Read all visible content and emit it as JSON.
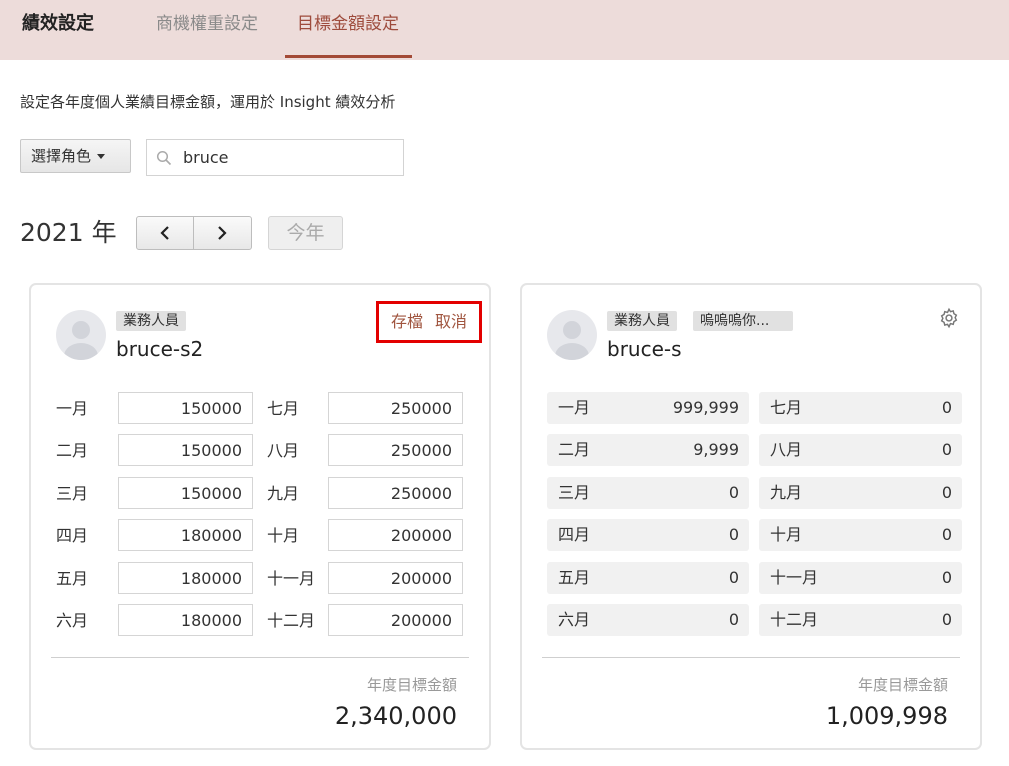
{
  "header": {
    "title": "績效設定",
    "tabs": [
      {
        "label": "商機權重設定",
        "active": false
      },
      {
        "label": "目標金額設定",
        "active": true
      }
    ]
  },
  "description": "設定各年度個人業績目標金額，運用於 Insight 績效分析",
  "filters": {
    "role_button": "選擇角色",
    "search_value": "bruce"
  },
  "year_nav": {
    "year_label": "2021 年",
    "today_label": "今年"
  },
  "cards": [
    {
      "badges": [
        "業務人員"
      ],
      "name": "bruce-s2",
      "editing": true,
      "save_label": "存檔",
      "cancel_label": "取消",
      "months_left": [
        {
          "label": "一月",
          "value": "150000"
        },
        {
          "label": "二月",
          "value": "150000"
        },
        {
          "label": "三月",
          "value": "150000"
        },
        {
          "label": "四月",
          "value": "180000"
        },
        {
          "label": "五月",
          "value": "180000"
        },
        {
          "label": "六月",
          "value": "180000"
        }
      ],
      "months_right": [
        {
          "label": "七月",
          "value": "250000"
        },
        {
          "label": "八月",
          "value": "250000"
        },
        {
          "label": "九月",
          "value": "250000"
        },
        {
          "label": "十月",
          "value": "200000"
        },
        {
          "label": "十一月",
          "value": "200000"
        },
        {
          "label": "十二月",
          "value": "200000"
        }
      ],
      "total_label": "年度目標金額",
      "total_value": "2,340,000"
    },
    {
      "badges": [
        "業務人員",
        "嗚嗚嗚你..."
      ],
      "name": "bruce-s",
      "editing": false,
      "months_left": [
        {
          "label": "一月",
          "value": "999,999"
        },
        {
          "label": "二月",
          "value": "9,999"
        },
        {
          "label": "三月",
          "value": "0"
        },
        {
          "label": "四月",
          "value": "0"
        },
        {
          "label": "五月",
          "value": "0"
        },
        {
          "label": "六月",
          "value": "0"
        }
      ],
      "months_right": [
        {
          "label": "七月",
          "value": "0"
        },
        {
          "label": "八月",
          "value": "0"
        },
        {
          "label": "九月",
          "value": "0"
        },
        {
          "label": "十月",
          "value": "0"
        },
        {
          "label": "十一月",
          "value": "0"
        },
        {
          "label": "十二月",
          "value": "0"
        }
      ],
      "total_label": "年度目標金額",
      "total_value": "1,009,998"
    }
  ],
  "colors": {
    "header_bg": "#eddcda",
    "accent": "#a34a36",
    "highlight_box": "#e30000"
  }
}
